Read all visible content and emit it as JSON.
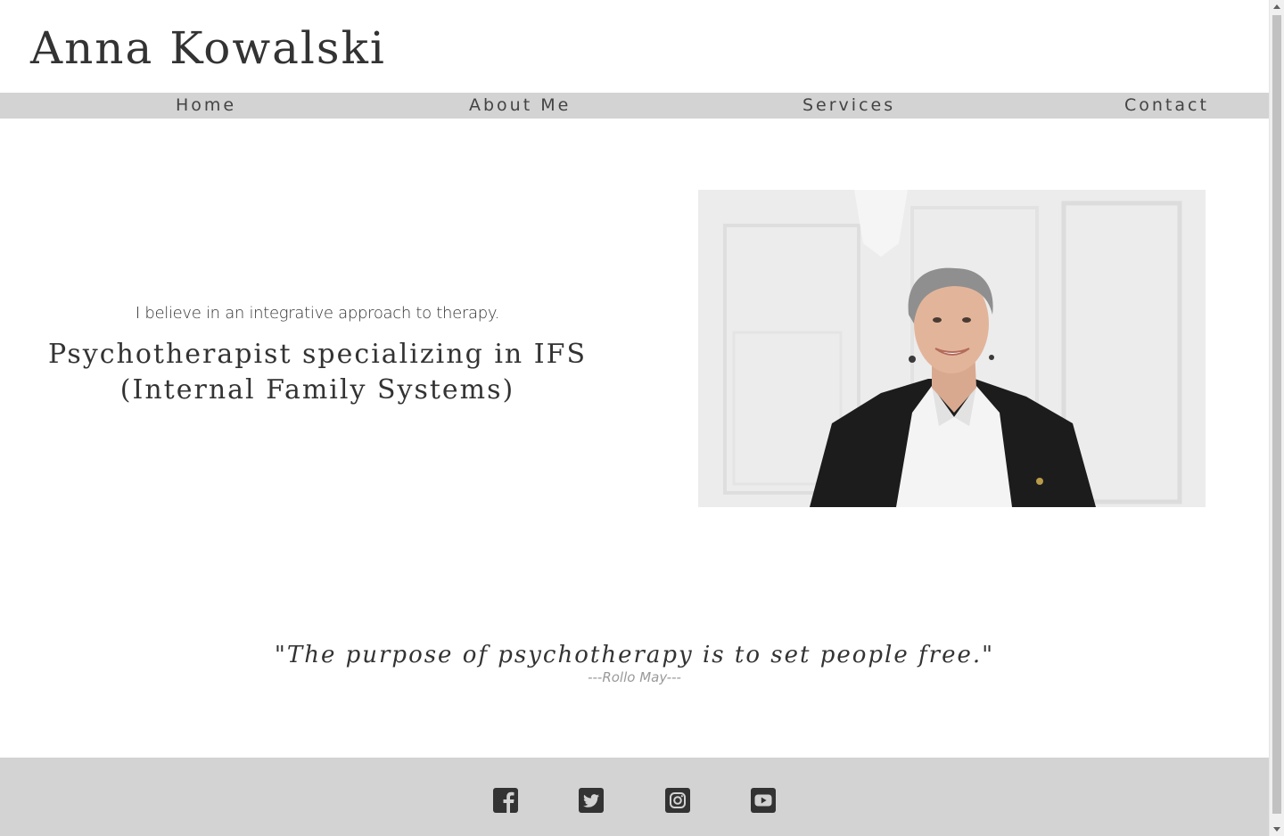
{
  "header": {
    "site_title": "Anna Kowalski"
  },
  "nav": {
    "items": [
      {
        "label": "Home"
      },
      {
        "label": "About Me"
      },
      {
        "label": "Services"
      },
      {
        "label": "Contact"
      }
    ]
  },
  "hero": {
    "tagline": "I believe in an integrative approach to therapy.",
    "heading": "Psychotherapist specializing in IFS (Internal Family Systems)",
    "photo_icon": "portrait-photo"
  },
  "quote": {
    "text": "\"The purpose of psychotherapy is to set people free.\"",
    "author": "---Rollo May---"
  },
  "footer": {
    "social": [
      {
        "icon": "facebook-icon"
      },
      {
        "icon": "twitter-icon"
      },
      {
        "icon": "instagram-icon"
      },
      {
        "icon": "youtube-icon"
      }
    ]
  },
  "colors": {
    "nav_background": "#d3d3d3",
    "footer_background": "#d3d3d3",
    "text": "#333333",
    "muted_text": "#9a9a9a",
    "icon": "#333333"
  }
}
